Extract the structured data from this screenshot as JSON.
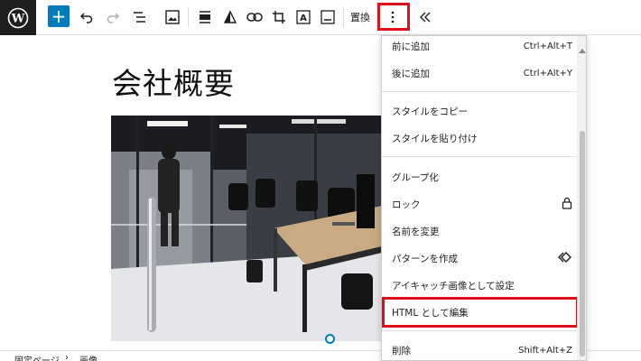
{
  "toolbar": {
    "replace_label": "置換",
    "icons": [
      "wordpress-logo",
      "add-block",
      "undo",
      "redo",
      "document-overview",
      "image",
      "align",
      "duotone",
      "link",
      "crop",
      "text-overlay",
      "caption",
      "more-options",
      "collapse"
    ]
  },
  "editor": {
    "page_title": "会社概要",
    "image_alt": "オフィス会議室の写真"
  },
  "footer": {
    "breadcrumb": [
      "固定ページ",
      "画像"
    ],
    "separator": "›"
  },
  "menu": {
    "items": [
      {
        "label": "前に追加",
        "shortcut": "Ctrl+Alt+T"
      },
      {
        "label": "後に追加",
        "shortcut": "Ctrl+Alt+Y"
      },
      {
        "label": "スタイルをコピー",
        "shortcut": ""
      },
      {
        "label": "スタイルを貼り付け",
        "shortcut": ""
      },
      {
        "label": "グループ化",
        "shortcut": ""
      },
      {
        "label": "ロック",
        "shortcut": "",
        "icon": "lock-icon"
      },
      {
        "label": "名前を変更",
        "shortcut": ""
      },
      {
        "label": "パターンを作成",
        "shortcut": "",
        "icon": "pattern-icon"
      },
      {
        "label": "アイキャッチ画像として設定",
        "shortcut": ""
      },
      {
        "label": "HTML として編集",
        "shortcut": ""
      },
      {
        "label": "削除",
        "shortcut": "Shift+Alt+Z"
      }
    ]
  },
  "colors": {
    "accent": "#007cba",
    "highlight": "#e0101b",
    "dark": "#1e1e1e"
  }
}
